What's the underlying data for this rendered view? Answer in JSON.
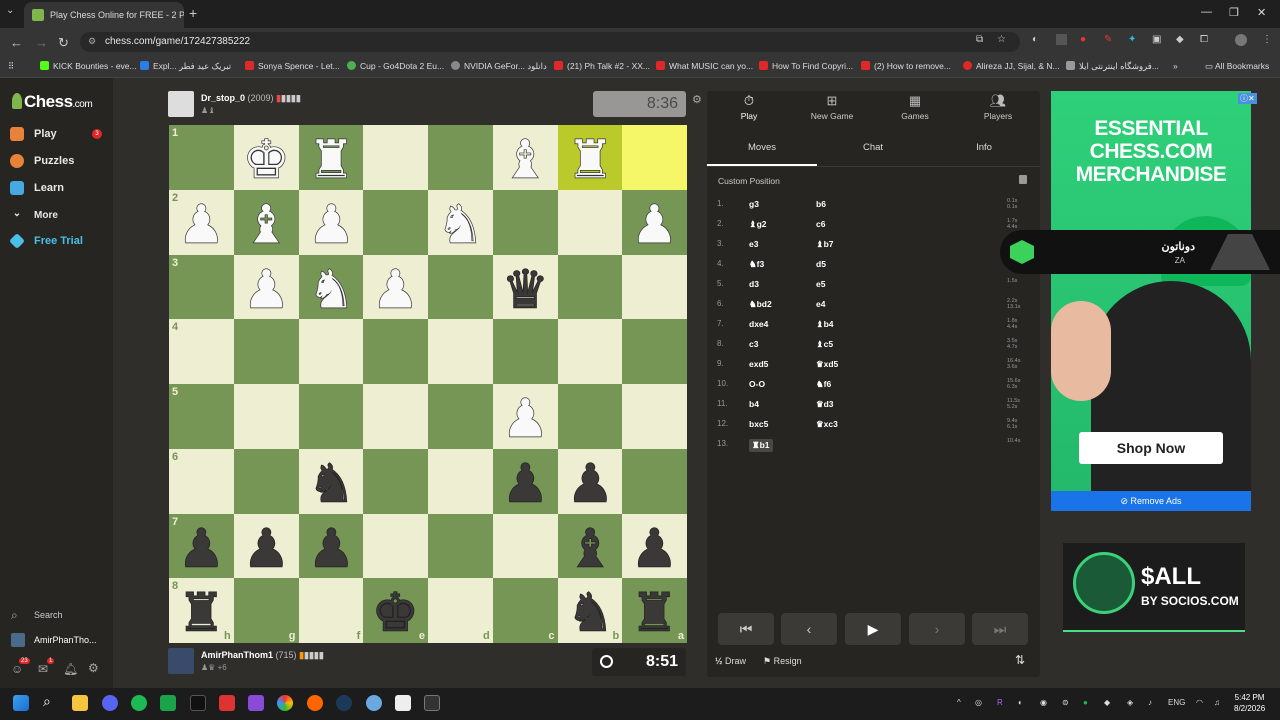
{
  "browser": {
    "tab_title": "Play Chess Online for FREE - 2 P",
    "url": "chess.com/game/172427385222",
    "bookmarks": [
      "KICK Bounties - eve...",
      "Expl... تبریک عید فطر",
      "Sonya Spence - Let...",
      "Cup - Go4Dota 2 Eu...",
      "NVIDIA GeFor... دانلود",
      "(21) Ph Talk #2 - XX...",
      "What MUSIC can yo...",
      "How To Find Copyri...",
      "(2) How to remove...",
      "Alireza JJ, Sijal, & N...",
      "فروشگاه اینترنتی ایلا..."
    ],
    "all_bookmarks": "All Bookmarks"
  },
  "sidebar": {
    "logo": "Chess",
    "logo_suffix": ".com",
    "items": [
      {
        "label": "Play",
        "color": "#e8823a"
      },
      {
        "label": "Puzzles",
        "color": "#e8823a"
      },
      {
        "label": "Learn",
        "color": "#47a9e0"
      },
      {
        "label": "More",
        "color": "#ffffff"
      },
      {
        "label": "Free Trial",
        "color": "#4ac0e8"
      }
    ],
    "play_badge": "3",
    "search": "Search",
    "user": "AmirPhanTho...",
    "notif_count_1": "23",
    "notif_count_2": "1"
  },
  "top_player": {
    "name": "Dr_stop_0",
    "rating": "(2009)",
    "clock": "8:36"
  },
  "bottom_player": {
    "name": "AmirPhanThom1",
    "rating": "(715)",
    "extra": "+6",
    "clock": "8:51"
  },
  "board": {
    "orientation": "black",
    "ranks": [
      "1",
      "2",
      "3",
      "4",
      "5",
      "6",
      "7",
      "8"
    ],
    "files": [
      "h",
      "g",
      "f",
      "e",
      "d",
      "c",
      "b",
      "a"
    ],
    "highlight": [
      "b1",
      "a1"
    ],
    "pieces": {
      "g1": "wK",
      "f1": "wR",
      "c1": "wB",
      "b1": "wR",
      "h2": "wP",
      "g2": "wB",
      "f2": "wP",
      "d2": "wN",
      "a2": "wP",
      "g3": "wP",
      "f3": "wN",
      "e3": "wP",
      "c3": "bQ",
      "c5": "wP",
      "f6": "bN",
      "c6": "bP",
      "b6": "bP",
      "h7": "bP",
      "g7": "bP",
      "f7": "bP",
      "b7": "bB",
      "a7": "bP",
      "h8": "bR",
      "e8": "bK",
      "b8": "bN",
      "a8": "bR"
    }
  },
  "panel": {
    "tabs": [
      "Play",
      "New Game",
      "Games",
      "Players"
    ],
    "subtabs": [
      "Moves",
      "Chat",
      "Info"
    ],
    "custom_position": "Custom Position",
    "moves": [
      {
        "n": "1.",
        "w": "g3",
        "b": "b6",
        "t": [
          "0.1s",
          "0.1s"
        ]
      },
      {
        "n": "2.",
        "w": "♝g2",
        "b": "c6",
        "t": [
          "1.7s",
          "4.4s"
        ]
      },
      {
        "n": "3.",
        "w": "e3",
        "b": "♝b7",
        "t": [
          "",
          ""
        ]
      },
      {
        "n": "4.",
        "w": "♞f3",
        "b": "d5",
        "t": [
          "",
          ""
        ]
      },
      {
        "n": "5.",
        "w": "d3",
        "b": "e5",
        "t": [
          "1.5s",
          ""
        ]
      },
      {
        "n": "6.",
        "w": "♞bd2",
        "b": "e4",
        "t": [
          "2.2s",
          "13.1s"
        ]
      },
      {
        "n": "7.",
        "w": "dxe4",
        "b": "♝b4",
        "t": [
          "1.8s",
          "4.4s"
        ]
      },
      {
        "n": "8.",
        "w": "c3",
        "b": "♝c5",
        "t": [
          "3.5s",
          "4.7s"
        ]
      },
      {
        "n": "9.",
        "w": "exd5",
        "b": "♛xd5",
        "t": [
          "16.4s",
          "3.6s"
        ]
      },
      {
        "n": "10.",
        "w": "O-O",
        "b": "♞f6",
        "t": [
          "15.6s",
          "6.3s"
        ]
      },
      {
        "n": "11.",
        "w": "b4",
        "b": "♛d3",
        "t": [
          "11.5s",
          "5.2s"
        ]
      },
      {
        "n": "12.",
        "w": "bxc5",
        "b": "♛xc3",
        "t": [
          "9.4s",
          "6.1s"
        ]
      },
      {
        "n": "13.",
        "w": "♜b1",
        "b": "",
        "t": [
          "10.4s",
          ""
        ]
      }
    ],
    "draw": "Draw",
    "draw_prefix": "½",
    "resign": "Resign"
  },
  "ads": {
    "headline": "ESSENTIAL CHESS.COM MERCHANDISE",
    "shop": "Shop Now",
    "remove": "Remove Ads",
    "overlay_text": "دوناتون",
    "overlay_sub": "ZA",
    "sall_title": "$ALL",
    "sall_sub": "BY SOCIOS.COM"
  },
  "taskbar": {
    "lang": "ENG",
    "time": "5:42 PM",
    "date": "8/2/2026"
  }
}
